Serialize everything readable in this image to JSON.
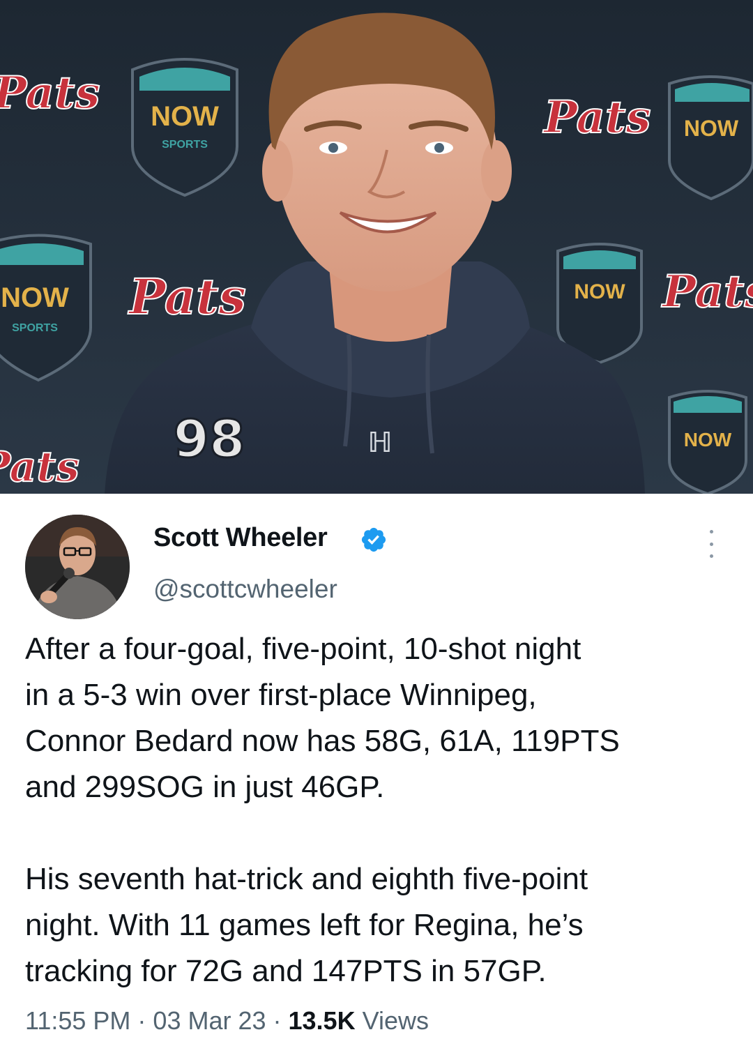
{
  "photo": {
    "backdrop_text_team": "Pats",
    "backdrop_badge_top": "NOW",
    "backdrop_badge_bottom": "SPORTS",
    "jersey_number": "98",
    "colors": {
      "backdrop": "#24313f",
      "badge": "#1f2a36",
      "teal": "#3fa3a3",
      "script_red": "#c8323c",
      "hoodie": "#2a3446"
    }
  },
  "tweet": {
    "author_name": "Scott Wheeler",
    "handle": "@scottcwheeler",
    "verified": true,
    "lines": [
      "After a four-goal, five-point, 10-shot night",
      "in a 5-3 win over first-place Winnipeg,",
      "Connor Bedard now has 58G, 61A, 119PTS",
      "and 299SOG in just 46GP.",
      "",
      "His seventh hat-trick and eighth five-point",
      "night. With 11 games left for Regina, he’s",
      "tracking for 72G and 147PTS in 57GP."
    ],
    "time": "11:55 PM",
    "separator": " · ",
    "date": "03 Mar 23",
    "views_count": "13.5K",
    "views_label": " Views",
    "colors": {
      "text": "#0f1419",
      "secondary": "#536471",
      "verified": "#1d9bf0"
    }
  }
}
